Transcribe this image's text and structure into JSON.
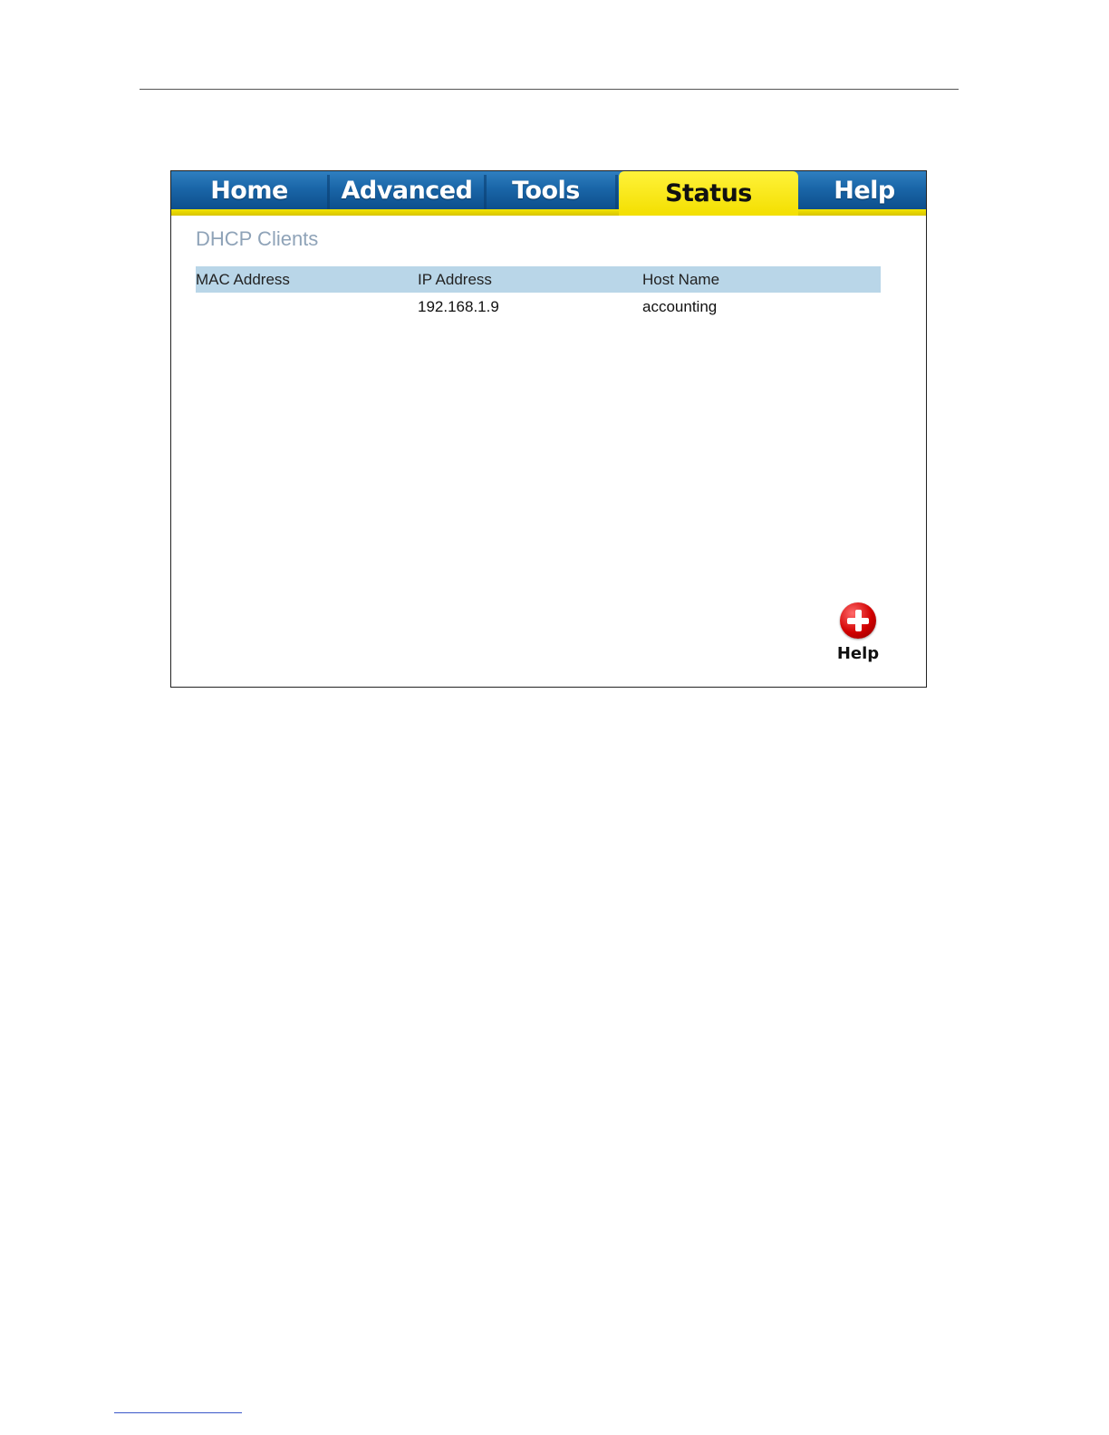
{
  "tabs": [
    {
      "label": "Home"
    },
    {
      "label": "Advanced"
    },
    {
      "label": "Tools"
    },
    {
      "label": "Status",
      "active": true
    },
    {
      "label": "Help"
    }
  ],
  "section": {
    "title": "DHCP Clients"
  },
  "table": {
    "columns": [
      "MAC Address",
      "IP Address",
      "Host Name"
    ],
    "rows": [
      {
        "mac": "",
        "ip": "192.168.1.9",
        "host": "accounting"
      }
    ]
  },
  "help_button": {
    "label": "Help",
    "icon": "plus-circle-icon"
  },
  "colors": {
    "tab_blue": "#1a66a8",
    "tab_active": "#f3df00",
    "header_row": "#b9d6e8",
    "title": "#8fa3b8",
    "help_red": "#d10000"
  }
}
